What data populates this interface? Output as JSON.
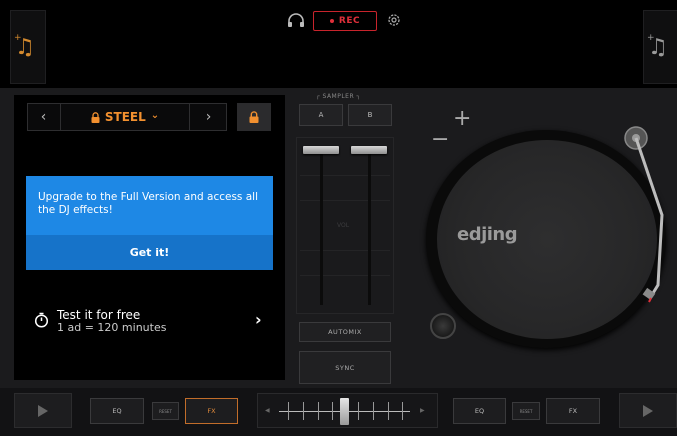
{
  "topbar": {
    "rec_label": "REC"
  },
  "fx": {
    "preset_name": "STEEL",
    "prev_symbol": "‹",
    "next_symbol": "›",
    "dropdown_symbol": "⌄"
  },
  "upgrade": {
    "message": "Upgrade to the Full Version and access all the DJ effects!",
    "cta": "Get it!"
  },
  "trial": {
    "title": "Test it for free",
    "subtitle": "1 ad = 120 minutes",
    "arrow": "›"
  },
  "mixer": {
    "sampler_label": "┌ SAMPLER ┐",
    "sampler_a": "A",
    "sampler_b": "B",
    "vol_label": "VOL",
    "automix_label": "AUTOMIX",
    "sync_label": "SYNC"
  },
  "turntable": {
    "brand": "edjing",
    "pitch_plus": "+",
    "pitch_minus": "−"
  },
  "bottombar": {
    "eq_label": "EQ",
    "reset_label": "RESET",
    "fx_label": "FX"
  },
  "colors": {
    "accent": "#f2902f",
    "rec": "#e0303a",
    "upgrade_blue": "#1e88e5"
  }
}
